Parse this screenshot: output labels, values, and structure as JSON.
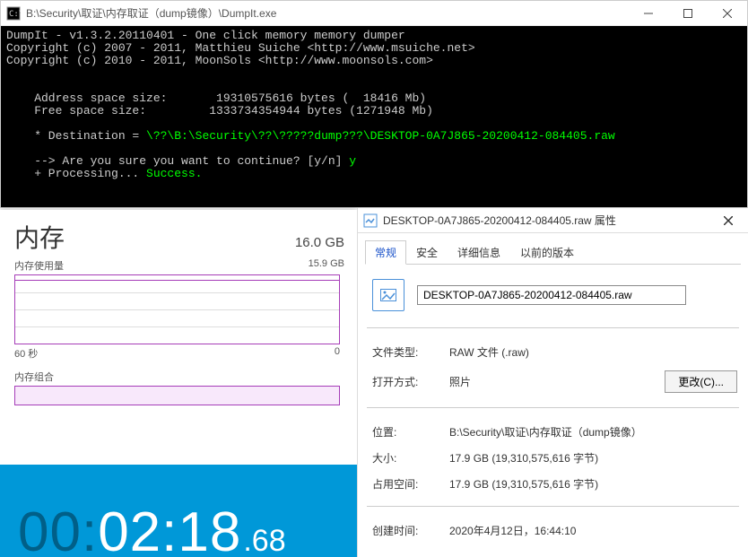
{
  "console": {
    "title": "B:\\Security\\取证\\内存取证（dump镜像）\\DumpIt.exe",
    "line1": "DumpIt - v1.3.2.20110401 - One click memory memory dumper",
    "line2": "Copyright (c) 2007 - 2011, Matthieu Suiche <http://www.msuiche.net>",
    "line3": "Copyright (c) 2010 - 2011, MoonSols <http://www.moonsols.com>",
    "addr": "    Address space size:       19310575616 bytes (  18416 Mb)",
    "free": "    Free space size:         1333734354944 bytes (1271948 Mb)",
    "dest_label": "    * Destination = ",
    "dest_path": "\\??\\B:\\Security\\??\\?????dump???\\DESKTOP-0A7J865-20200412-084405.raw",
    "confirm_q": "    --> Are you sure you want to continue? [y/n] ",
    "confirm_a": "y",
    "proc": "    + Processing... ",
    "proc_status": "Success."
  },
  "mem": {
    "title": "内存",
    "total": "16.0 GB",
    "usage_label": "内存使用量",
    "usage_value": "15.9 GB",
    "axis_left": "60 秒",
    "axis_right": "0",
    "comp_label": "内存组合"
  },
  "timer": {
    "dim": "00:",
    "main": "02:18",
    "frac": ".68"
  },
  "props": {
    "title": "DESKTOP-0A7J865-20200412-084405.raw 属性",
    "tabs": {
      "general": "常规",
      "security": "安全",
      "details": "详细信息",
      "versions": "以前的版本"
    },
    "filename": "DESKTOP-0A7J865-20200412-084405.raw",
    "type_k": "文件类型:",
    "type_v": "RAW 文件 (.raw)",
    "open_k": "打开方式:",
    "open_v": "照片",
    "change_btn": "更改(C)...",
    "loc_k": "位置:",
    "loc_v": "B:\\Security\\取证\\内存取证（dump镜像）",
    "size_k": "大小:",
    "size_v": "17.9 GB (19,310,575,616 字节)",
    "disk_k": "占用空间:",
    "disk_v": "17.9 GB (19,310,575,616 字节)",
    "ctime_k": "创建时间:",
    "ctime_v": "2020年4月12日，16:44:10"
  }
}
